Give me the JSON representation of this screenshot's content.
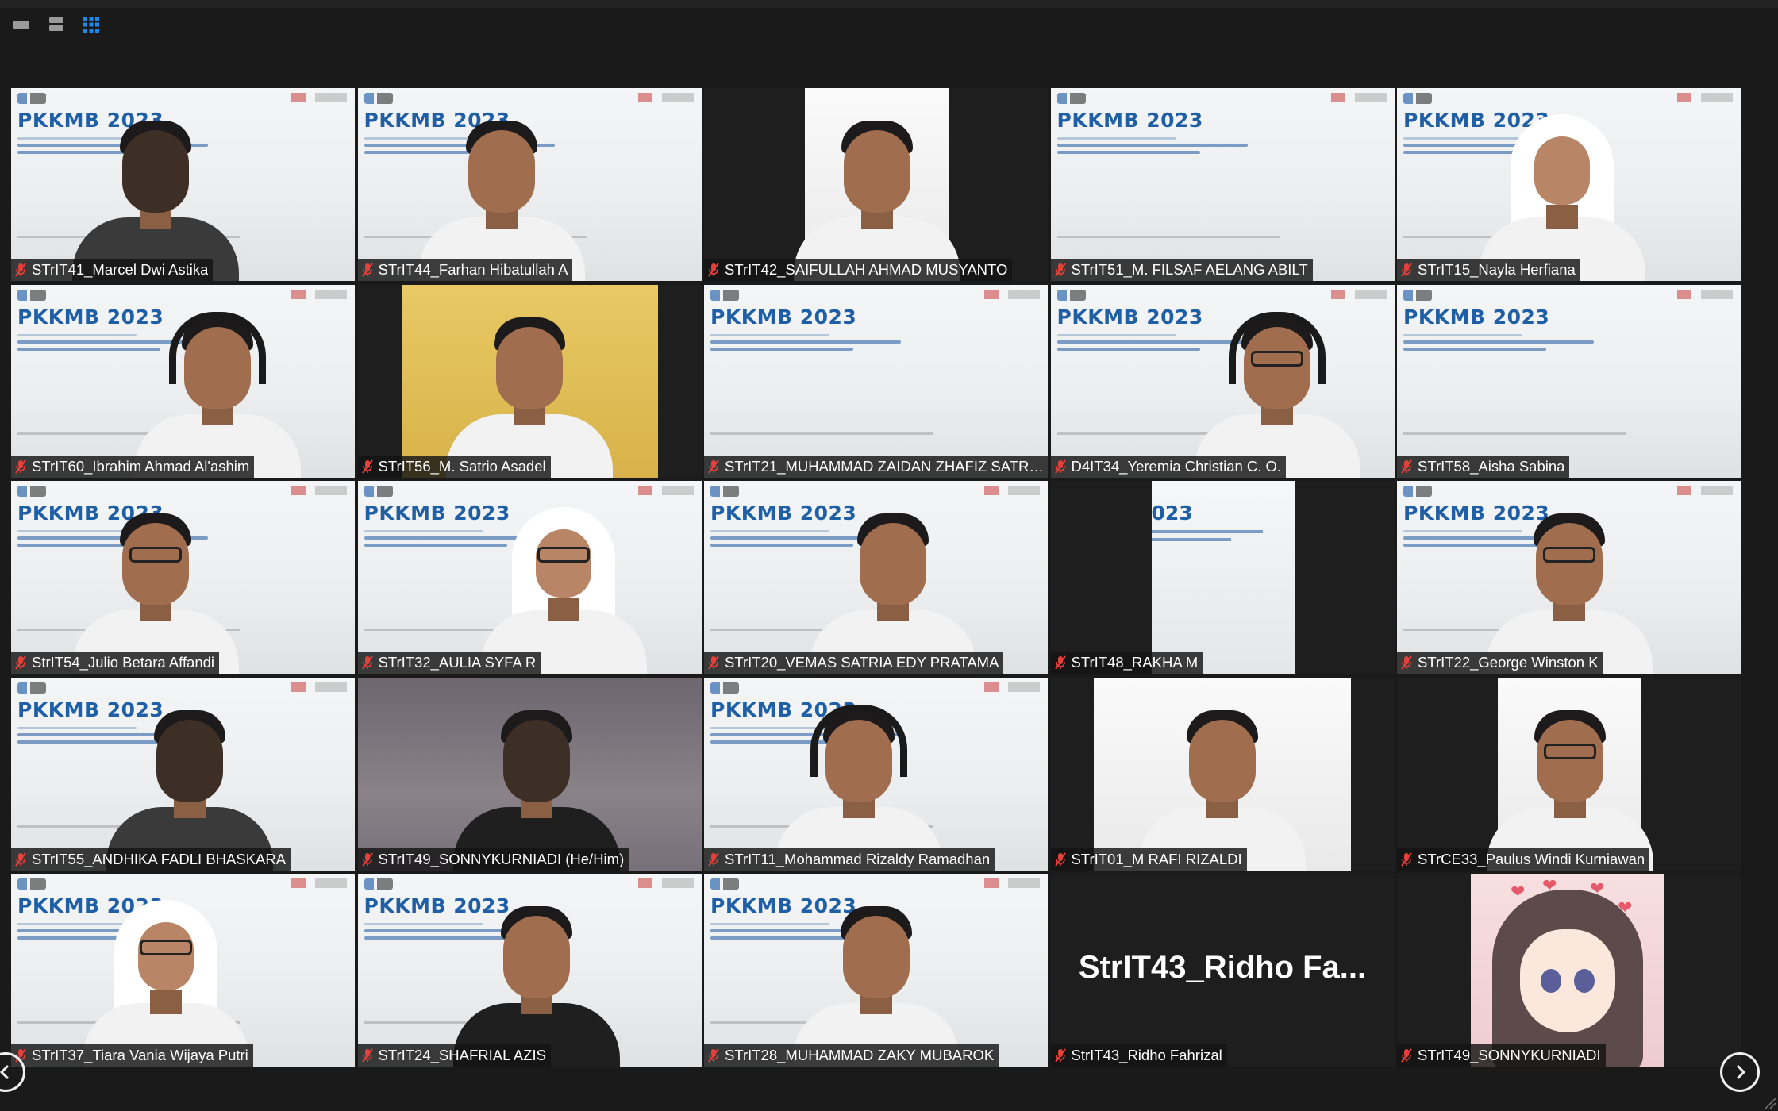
{
  "toolbar": {
    "view_buttons": [
      {
        "icon": "speaker-view-icon",
        "active": false
      },
      {
        "icon": "gallery-strip-icon",
        "active": false
      },
      {
        "icon": "gallery-grid-icon",
        "active": true
      }
    ]
  },
  "colors": {
    "background": "#1a1a1a",
    "accent": "#1a88e8",
    "muted_mic": "#e5413a",
    "slide_title": "#1f5fa5"
  },
  "slide_background": {
    "title": "PKKMB 2023"
  },
  "participants": [
    {
      "name": "STrIT41_Marcel Dwi Astika",
      "video": "slide",
      "muted": true
    },
    {
      "name": "STrIT44_Farhan Hibatullah A",
      "video": "slide",
      "muted": true
    },
    {
      "name": "STrIT42_SAIFULLAH AHMAD MUSYANTO",
      "video": "inset-white",
      "muted": true
    },
    {
      "name": "STrIT51_M. FILSAF AELANG ABILT",
      "video": "slide",
      "muted": true
    },
    {
      "name": "STrIT15_Nayla Herfiana",
      "video": "slide",
      "muted": true
    },
    {
      "name": "STrIT60_Ibrahim Ahmad Al'ashim",
      "video": "slide",
      "muted": true
    },
    {
      "name": "STrIT56_M. Satrio Asadel",
      "video": "inset-yellow",
      "muted": true
    },
    {
      "name": "STrIT21_MUHAMMAD ZAIDAN ZHAFIZ SATRI...",
      "video": "slide",
      "muted": true
    },
    {
      "name": "D4IT34_Yeremia Christian C. O.",
      "video": "slide",
      "muted": true
    },
    {
      "name": "STrIT58_Aisha Sabina",
      "video": "slide",
      "muted": true
    },
    {
      "name": "StrIT54_Julio Betara Affandi",
      "video": "slide",
      "muted": true
    },
    {
      "name": "STrIT32_AULIA SYFA R",
      "video": "slide",
      "muted": true
    },
    {
      "name": "STrIT20_VEMAS SATRIA EDY PRATAMA",
      "video": "slide",
      "muted": true
    },
    {
      "name": "STrIT48_RAKHA M",
      "video": "inset-slide",
      "muted": true
    },
    {
      "name": "STrIT22_George Winston K",
      "video": "slide",
      "muted": true
    },
    {
      "name": "STrIT55_ANDHIKA FADLI BHASKARA",
      "video": "slide",
      "muted": true
    },
    {
      "name": "STrIT49_SONNYKURNIADI (He/Him)",
      "video": "room",
      "muted": true
    },
    {
      "name": "STrIT11_Mohammad Rizaldy Ramadhan",
      "video": "slide",
      "muted": true
    },
    {
      "name": "STrIT01_M RAFI RIZALDI",
      "video": "inset-white",
      "muted": true
    },
    {
      "name": "STrCE33_Paulus Windi Kurniawan",
      "video": "inset-white",
      "muted": true
    },
    {
      "name": "STrIT37_Tiara Vania Wijaya Putri",
      "video": "slide",
      "muted": true
    },
    {
      "name": "STrIT24_SHAFRIAL AZIS",
      "video": "slide",
      "muted": true
    },
    {
      "name": "STrIT28_MUHAMMAD ZAKY MUBAROK",
      "video": "slide",
      "muted": true
    },
    {
      "name": "StrIT43_Ridho Fahrizal",
      "video": "off",
      "display_name": "StrIT43_Ridho  Fa...",
      "muted": true
    },
    {
      "name": "STrIT49_SONNYKURNIADI",
      "video": "inset-pink",
      "muted": true
    }
  ],
  "pagination": {
    "prev_icon": "chevron-left-icon",
    "next_icon": "chevron-right-icon"
  }
}
